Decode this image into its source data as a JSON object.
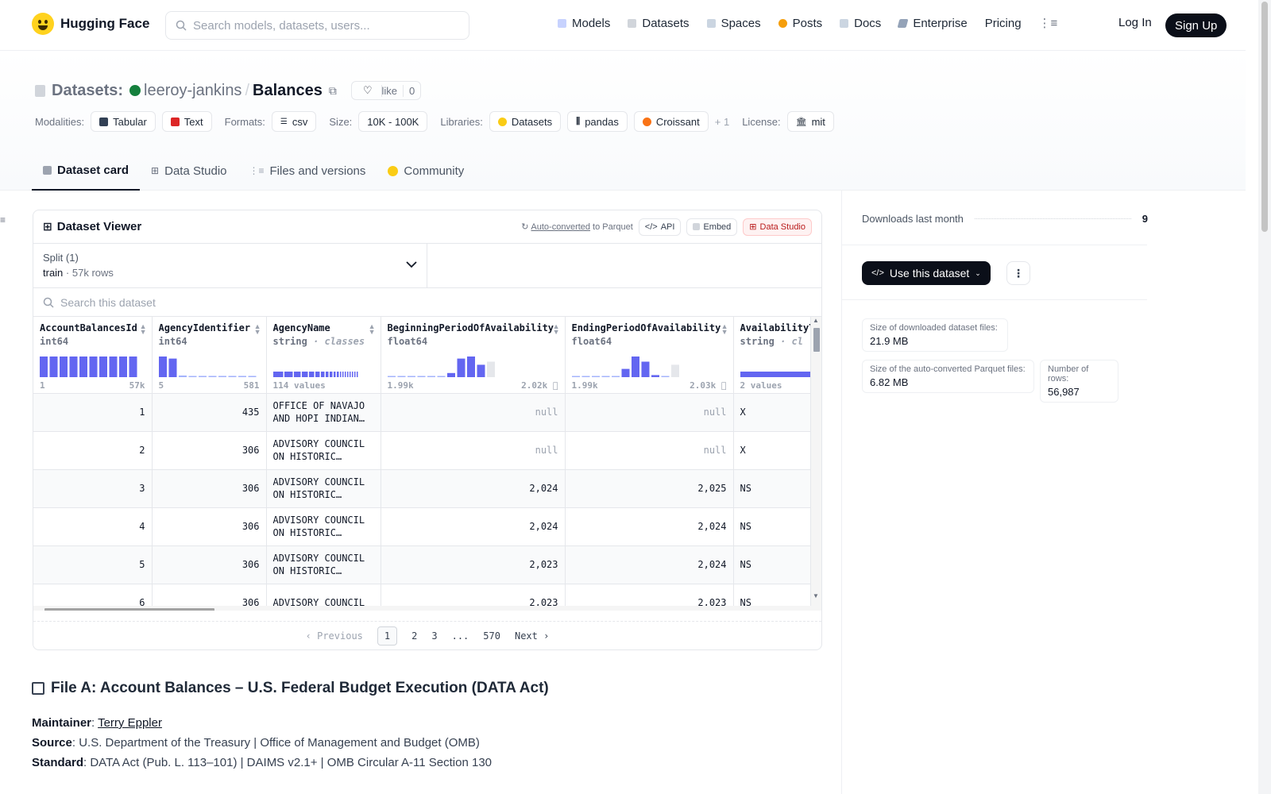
{
  "nav": {
    "brand": "Hugging Face",
    "search_placeholder": "Search models, datasets, users...",
    "links": [
      "Models",
      "Datasets",
      "Spaces",
      "Posts",
      "Docs",
      "Enterprise",
      "Pricing"
    ],
    "login": "Log In",
    "signup": "Sign Up"
  },
  "header": {
    "section": "Datasets:",
    "user": "leeroy-jankins",
    "slash": "/",
    "name": "Balances",
    "like_label": "like",
    "like_count": "0",
    "modalities_label": "Modalities:",
    "modalities": [
      "Tabular",
      "Text"
    ],
    "formats_label": "Formats:",
    "format": "csv",
    "size_label": "Size:",
    "size": "10K - 100K",
    "libraries_label": "Libraries:",
    "libraries": [
      "Datasets",
      "pandas",
      "Croissant"
    ],
    "libraries_more": "+ 1",
    "license_label": "License:",
    "license": "mit",
    "tabs": [
      "Dataset card",
      "Data Studio",
      "Files and versions",
      "Community"
    ]
  },
  "viewer": {
    "title": "Dataset Viewer",
    "auto_converted": "Auto-converted",
    "to_parquet": "to Parquet",
    "api": "API",
    "embed": "Embed",
    "data_studio": "Data Studio",
    "split_label": "Split (1)",
    "split_name": "train",
    "split_dot": "·",
    "split_rows": "57k rows",
    "search_placeholder": "Search this dataset",
    "columns": [
      {
        "name": "AccountBalancesId",
        "type": "int64",
        "classes": "",
        "min": "1",
        "max": "57k"
      },
      {
        "name": "AgencyIdentifier",
        "type": "int64",
        "classes": "",
        "min": "5",
        "max": "581"
      },
      {
        "name": "AgencyName",
        "type": "string",
        "classes": "· classes",
        "min": "114 values",
        "max": ""
      },
      {
        "name": "BeginningPeriodOfAvailability",
        "type": "float64",
        "classes": "",
        "min": "1.99k",
        "max": "2.02k ⃠"
      },
      {
        "name": "EndingPeriodOfAvailability",
        "type": "float64",
        "classes": "",
        "min": "1.99k",
        "max": "2.03k ⃠"
      },
      {
        "name": "AvailabilityTypeCode",
        "type": "string",
        "classes": "· cl",
        "min": "2 values",
        "max": ""
      }
    ],
    "rows": [
      [
        "1",
        "435",
        "OFFICE OF NAVAJO AND HOPI INDIAN…",
        "null",
        "null",
        "X"
      ],
      [
        "2",
        "306",
        "ADVISORY COUNCIL ON HISTORIC…",
        "null",
        "null",
        "X"
      ],
      [
        "3",
        "306",
        "ADVISORY COUNCIL ON HISTORIC…",
        "2,024",
        "2,025",
        "NS"
      ],
      [
        "4",
        "306",
        "ADVISORY COUNCIL ON HISTORIC…",
        "2,024",
        "2,024",
        "NS"
      ],
      [
        "5",
        "306",
        "ADVISORY COUNCIL ON HISTORIC…",
        "2,023",
        "2,024",
        "NS"
      ],
      [
        "6",
        "306",
        "ADVISORY COUNCIL",
        "2,023",
        "2,023",
        "NS"
      ]
    ],
    "pager": {
      "prev": "Previous",
      "pages": [
        "1",
        "2",
        "3",
        "...",
        "570"
      ],
      "next": "Next"
    }
  },
  "readme": {
    "title": "File A: Account Balances – U.S. Federal Budget Execution (DATA Act)",
    "maintainer_label": "Maintainer",
    "maintainer": "Terry Eppler",
    "source_label": "Source",
    "source": ": U.S. Department of the Treasury | Office of Management and Budget (OMB)",
    "standard_label": "Standard",
    "standard": ": DATA Act (Pub. L. 113–101) | DAIMS v2.1+ | OMB Circular A-11 Section 130"
  },
  "sidebar": {
    "downloads_label": "Downloads last month",
    "downloads": "9",
    "use_dataset": "Use this dataset",
    "dl_size_label": "Size of downloaded dataset files:",
    "dl_size": "21.9 MB",
    "parquet_size_label": "Size of the auto-converted Parquet files:",
    "parquet_size": "6.82 MB",
    "rows_label": "Number of rows:",
    "rows": "56,987"
  },
  "colors": {
    "accent": "#6366f1",
    "accent_muted": "#e5e7eb",
    "dark": "#0b0f19"
  }
}
